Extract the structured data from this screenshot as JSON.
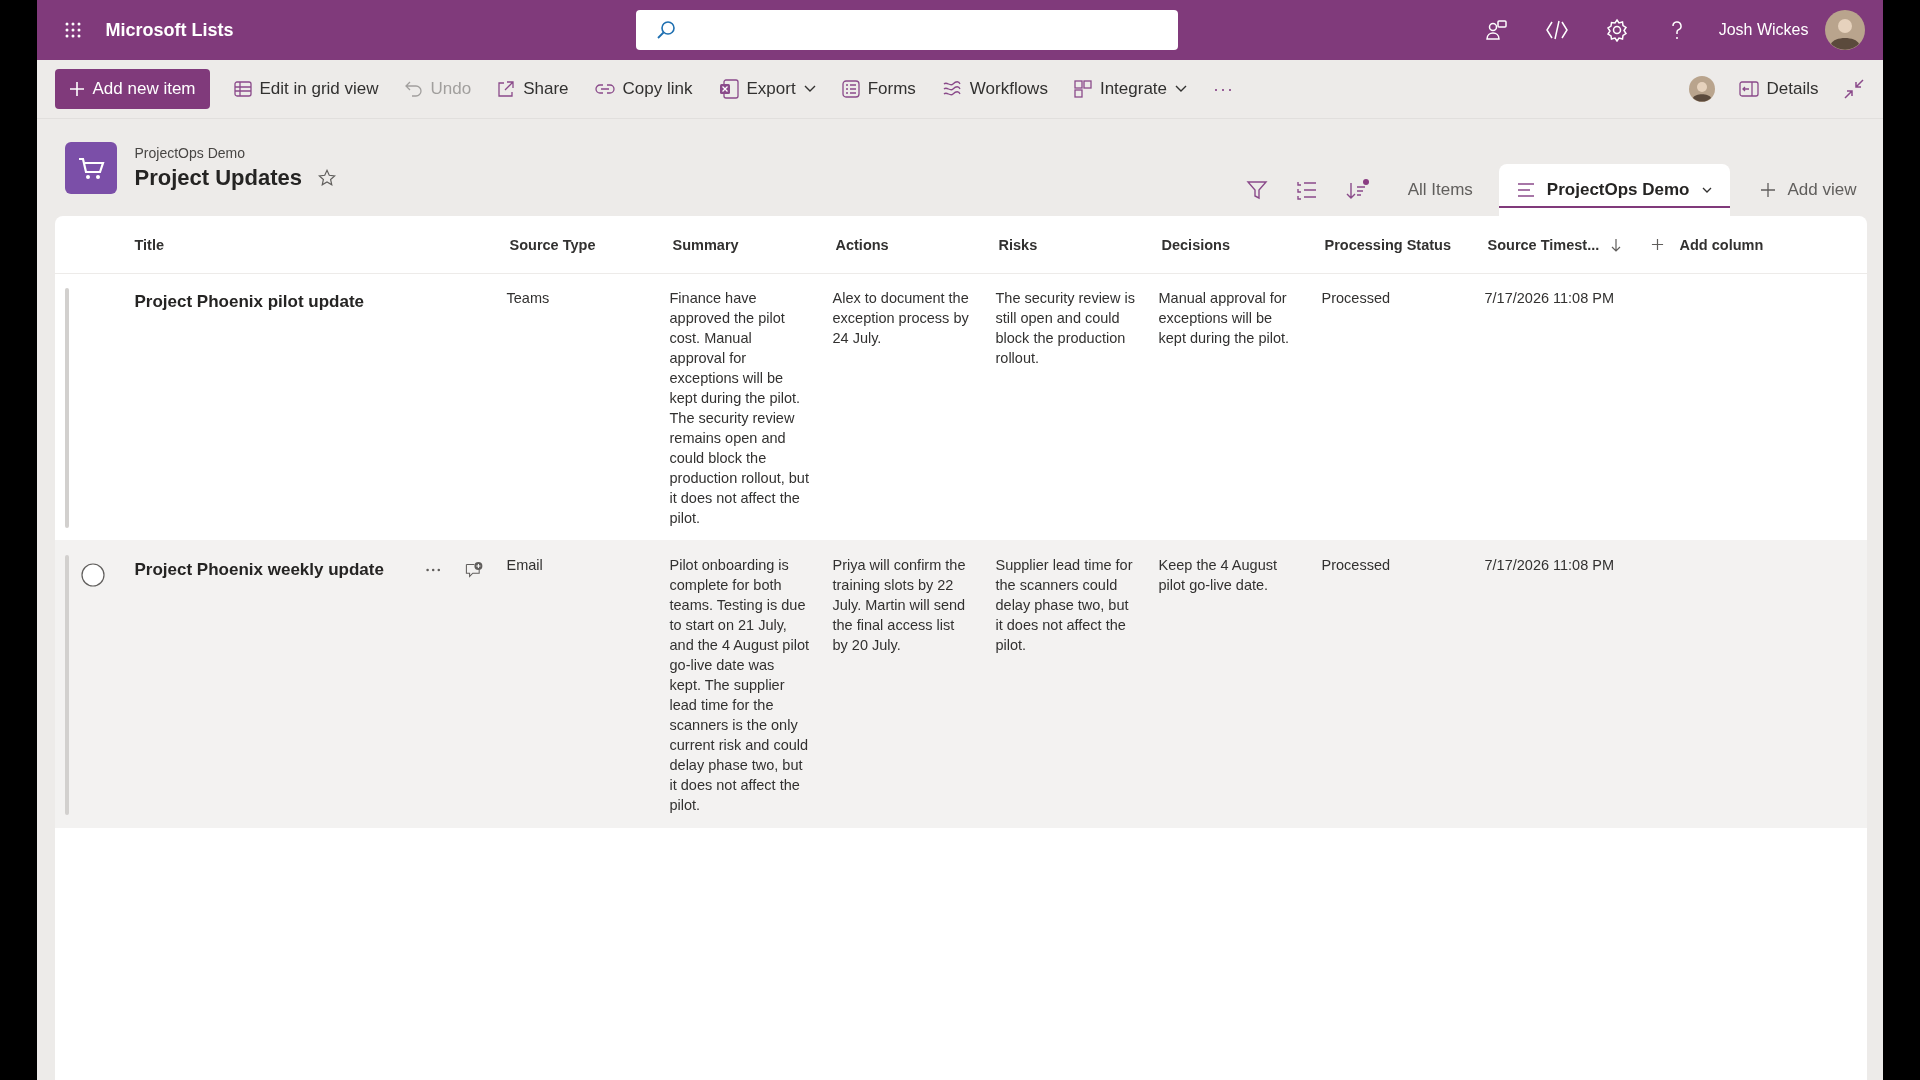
{
  "app_bar": {
    "app_name": "Microsoft Lists",
    "user_name": "Josh Wickes"
  },
  "toolbar": {
    "items": [
      {
        "label": "Add new item",
        "kind": "primary",
        "disabled": false
      },
      {
        "label": "Edit in grid view",
        "kind": "button",
        "disabled": false
      },
      {
        "label": "Undo",
        "kind": "button",
        "disabled": true
      },
      {
        "label": "Share",
        "kind": "button",
        "disabled": false
      },
      {
        "label": "Copy link",
        "kind": "button",
        "disabled": false
      },
      {
        "label": "Export",
        "kind": "dropdown",
        "disabled": false
      },
      {
        "label": "Forms",
        "kind": "button",
        "disabled": false
      },
      {
        "label": "Workflows",
        "kind": "button",
        "disabled": false
      },
      {
        "label": "Integrate",
        "kind": "dropdown",
        "disabled": false
      },
      {
        "label": "···",
        "kind": "more",
        "disabled": false
      }
    ],
    "details_label": "Details"
  },
  "list_header": {
    "site": "ProjectOps Demo",
    "title": "Project Updates",
    "favorite": false
  },
  "views": {
    "items": [
      {
        "label": "All Items",
        "selected": false
      },
      {
        "label": "ProjectOps Demo",
        "selected": true
      }
    ],
    "add_label": "Add view"
  },
  "table": {
    "columns": [
      {
        "label": "Title",
        "sorted": false
      },
      {
        "label": "Source Type",
        "sorted": false
      },
      {
        "label": "Summary",
        "sorted": false
      },
      {
        "label": "Actions",
        "sorted": false
      },
      {
        "label": "Risks",
        "sorted": false
      },
      {
        "label": "Decisions",
        "sorted": false
      },
      {
        "label": "Processing Status",
        "sorted": false
      },
      {
        "label": "Source Timest...",
        "sorted": true
      }
    ],
    "add_column": "Add column",
    "rows": [
      {
        "selected": false,
        "hovered": false,
        "cells": [
          "Project Phoenix pilot update",
          "Teams",
          "Finance have approved the pilot cost. Manual approval for exceptions will be kept during the pilot. The security review remains open and could block the production rollout, but it does not affect the pilot.",
          "Alex to document the exception process by 24 July.",
          "The security review is still open and could block the production rollout.",
          "Manual approval for exceptions will be kept during the pilot.",
          "Processed",
          "7/17/2026 11:08 PM"
        ]
      },
      {
        "selected": false,
        "hovered": true,
        "cells": [
          "Project Phoenix weekly update",
          "Email",
          "Pilot onboarding is complete for both teams. Testing is due to start on 21 July, and the 4 August pilot go-live date was kept. The supplier lead time for the scanners is the only current risk and could delay phase two, but it does not affect the pilot.",
          "Priya will confirm the training slots by 22 July. Martin will send the final access list by 20 July.",
          "Supplier lead time for the scanners could delay phase two, but it does not affect the pilot.",
          "Keep the 4 August pilot go-live date.",
          "Processed",
          "7/17/2026 11:08 PM"
        ]
      }
    ]
  }
}
